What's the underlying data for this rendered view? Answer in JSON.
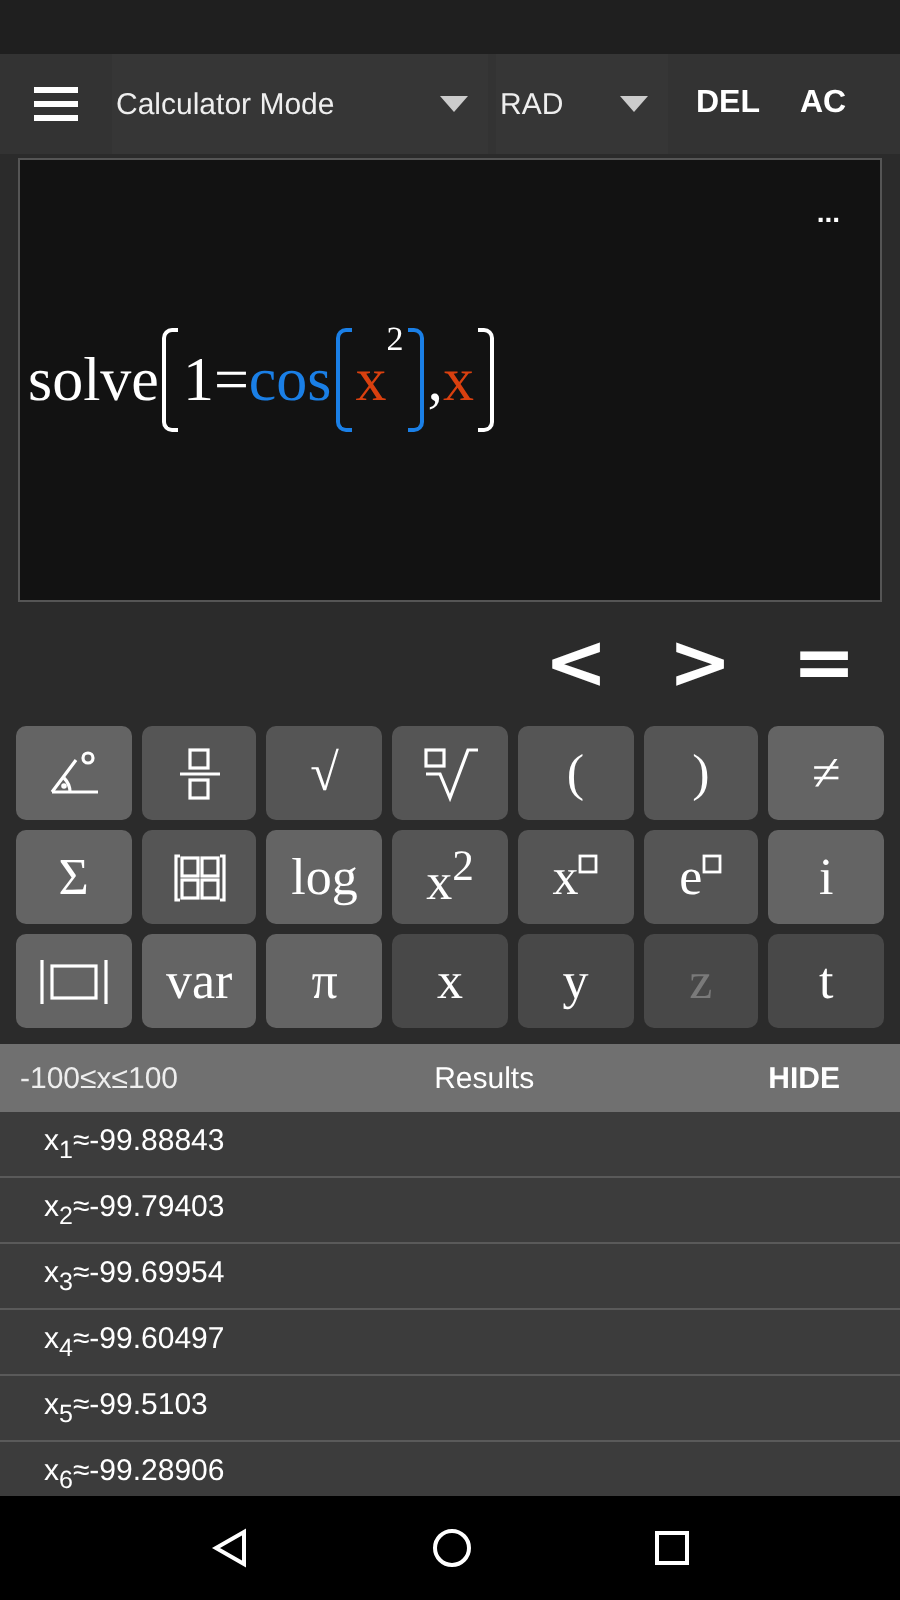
{
  "toolbar": {
    "mode": "Calculator Mode",
    "angle_unit": "RAD",
    "buttons": [
      "DEL",
      "AC"
    ]
  },
  "display": {
    "more": "...",
    "expression": [
      {
        "kind": "text",
        "text": "solve",
        "color": "#ffffff"
      },
      {
        "kind": "open",
        "color": "#ffffff"
      },
      {
        "kind": "text",
        "text": "1",
        "color": "#ffffff"
      },
      {
        "kind": "text",
        "text": "=",
        "color": "#ffffff"
      },
      {
        "kind": "text",
        "text": "cos",
        "color": "#1a7fe6"
      },
      {
        "kind": "open",
        "color": "#1a7fe6"
      },
      {
        "kind": "text",
        "text": "x",
        "color": "#d9400f"
      },
      {
        "kind": "sup",
        "text": "2",
        "color": "#ffffff"
      },
      {
        "kind": "close",
        "color": "#1a7fe6"
      },
      {
        "kind": "text",
        "text": ",",
        "color": "#ffffff"
      },
      {
        "kind": "text",
        "text": "x",
        "color": "#d9400f"
      },
      {
        "kind": "close",
        "color": "#ffffff"
      }
    ]
  },
  "navigation": [
    "<",
    ">",
    "="
  ],
  "keypad": [
    [
      {
        "kind": "angle",
        "color": "#646464",
        "disabled": false
      },
      {
        "kind": "fraction",
        "color": "#555555",
        "disabled": false
      },
      {
        "kind": "text",
        "label": "√",
        "color": "#555555",
        "disabled": false
      },
      {
        "kind": "root",
        "color": "#555555",
        "disabled": false
      },
      {
        "kind": "text",
        "label": "(",
        "color": "#555555",
        "disabled": false
      },
      {
        "kind": "text",
        "label": ")",
        "color": "#555555",
        "disabled": false
      },
      {
        "kind": "text",
        "label": "≠",
        "color": "#646464",
        "disabled": false
      }
    ],
    [
      {
        "kind": "text",
        "label": "Σ",
        "color": "#646464",
        "disabled": false
      },
      {
        "kind": "matrix",
        "color": "#555555",
        "disabled": false
      },
      {
        "kind": "text",
        "label": "log",
        "color": "#646464",
        "disabled": false
      },
      {
        "kind": "text",
        "label": "x$^{2}$",
        "color": "#555555",
        "disabled": false
      },
      {
        "kind": "power",
        "label": "x",
        "color": "#555555",
        "disabled": false
      },
      {
        "kind": "power",
        "label": "e",
        "color": "#555555",
        "disabled": false
      },
      {
        "kind": "text",
        "label": "i",
        "color": "#646464",
        "disabled": false
      }
    ],
    [
      {
        "kind": "abs",
        "color": "#646464",
        "disabled": false
      },
      {
        "kind": "text",
        "label": "var",
        "color": "#646464",
        "disabled": false
      },
      {
        "kind": "text",
        "label": "π",
        "color": "#646464",
        "disabled": false
      },
      {
        "kind": "text",
        "label": "x",
        "color": "#484848",
        "disabled": false
      },
      {
        "kind": "text",
        "label": "y",
        "color": "#484848",
        "disabled": false
      },
      {
        "kind": "text",
        "label": "z",
        "color": "#484848",
        "disabled": true
      },
      {
        "kind": "text",
        "label": "t",
        "color": "#484848",
        "disabled": false
      }
    ]
  ],
  "results": {
    "range": "-100≤x≤100",
    "title": "Results",
    "hide": "HIDE",
    "rows": [
      "x$_{1}$≈-99.88843",
      "x$_{2}$≈-99.79403",
      "x$_{3}$≈-99.69954",
      "x$_{4}$≈-99.60497",
      "x$_{5}$≈-99.5103",
      "x$_{6}$≈-99.28906"
    ]
  }
}
